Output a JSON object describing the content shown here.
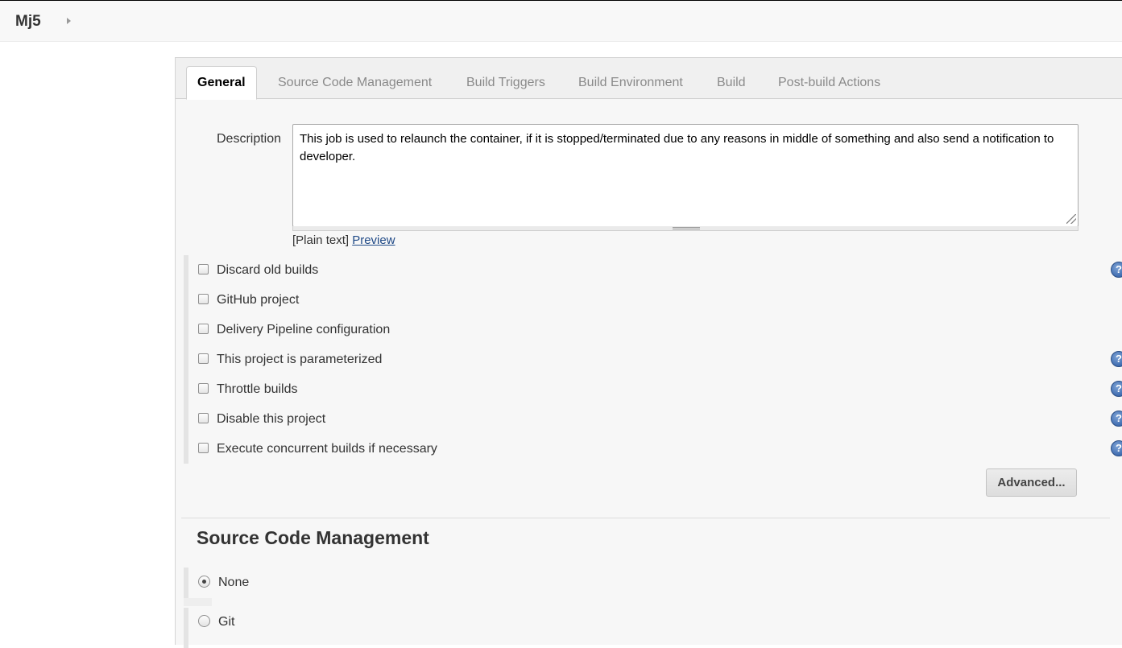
{
  "breadcrumb": {
    "job_name": "Mj5"
  },
  "tabs": [
    {
      "label": "General",
      "active": true
    },
    {
      "label": "Source Code Management",
      "active": false
    },
    {
      "label": "Build Triggers",
      "active": false
    },
    {
      "label": "Build Environment",
      "active": false
    },
    {
      "label": "Build",
      "active": false
    },
    {
      "label": "Post-build Actions",
      "active": false
    }
  ],
  "general": {
    "description_label": "Description",
    "description_value": "This job is used to relaunch the container, if it is stopped/terminated due to any reasons in middle of something and also send a notification to developer.",
    "format_text": "[Plain text]",
    "preview_link": "Preview",
    "options": [
      {
        "label": "Discard old builds",
        "checked": false,
        "help": true
      },
      {
        "label": "GitHub project",
        "checked": false,
        "help": false
      },
      {
        "label": "Delivery Pipeline configuration",
        "checked": false,
        "help": false
      },
      {
        "label": "This project is parameterized",
        "checked": false,
        "help": true
      },
      {
        "label": "Throttle builds",
        "checked": false,
        "help": true
      },
      {
        "label": "Disable this project",
        "checked": false,
        "help": true
      },
      {
        "label": "Execute concurrent builds if necessary",
        "checked": false,
        "help": true
      }
    ],
    "advanced_button": "Advanced...",
    "help_glyph": "?"
  },
  "scm": {
    "title": "Source Code Management",
    "options": [
      {
        "label": "None",
        "selected": true
      },
      {
        "label": "Git",
        "selected": false
      }
    ]
  },
  "colors": {
    "panel_bg": "#f7f7f7",
    "tab_bar_bg": "#f0f0f0",
    "link": "#204a87",
    "help_icon": "#3f6cb0"
  }
}
